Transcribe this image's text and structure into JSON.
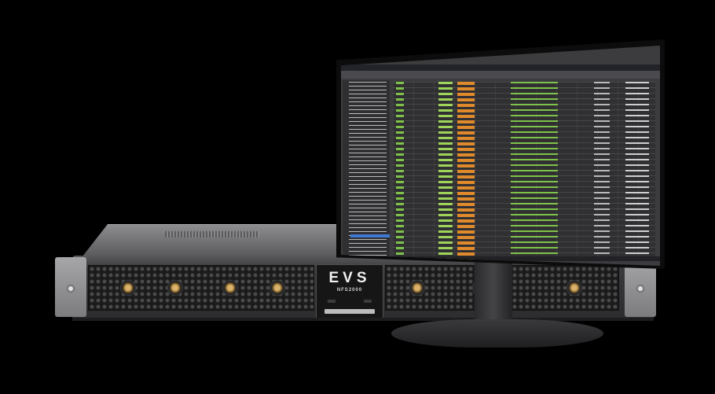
{
  "rack_unit": {
    "brand": "EVS",
    "model": "NFS2000"
  },
  "colors": {
    "background": "#000000",
    "chassis": "#2c2c2e",
    "screen_bg": "#3c3c3f",
    "accent_green": "#7fc24a",
    "accent_orange": "#e08a2c",
    "highlight_blue": "#3f7fe0"
  }
}
